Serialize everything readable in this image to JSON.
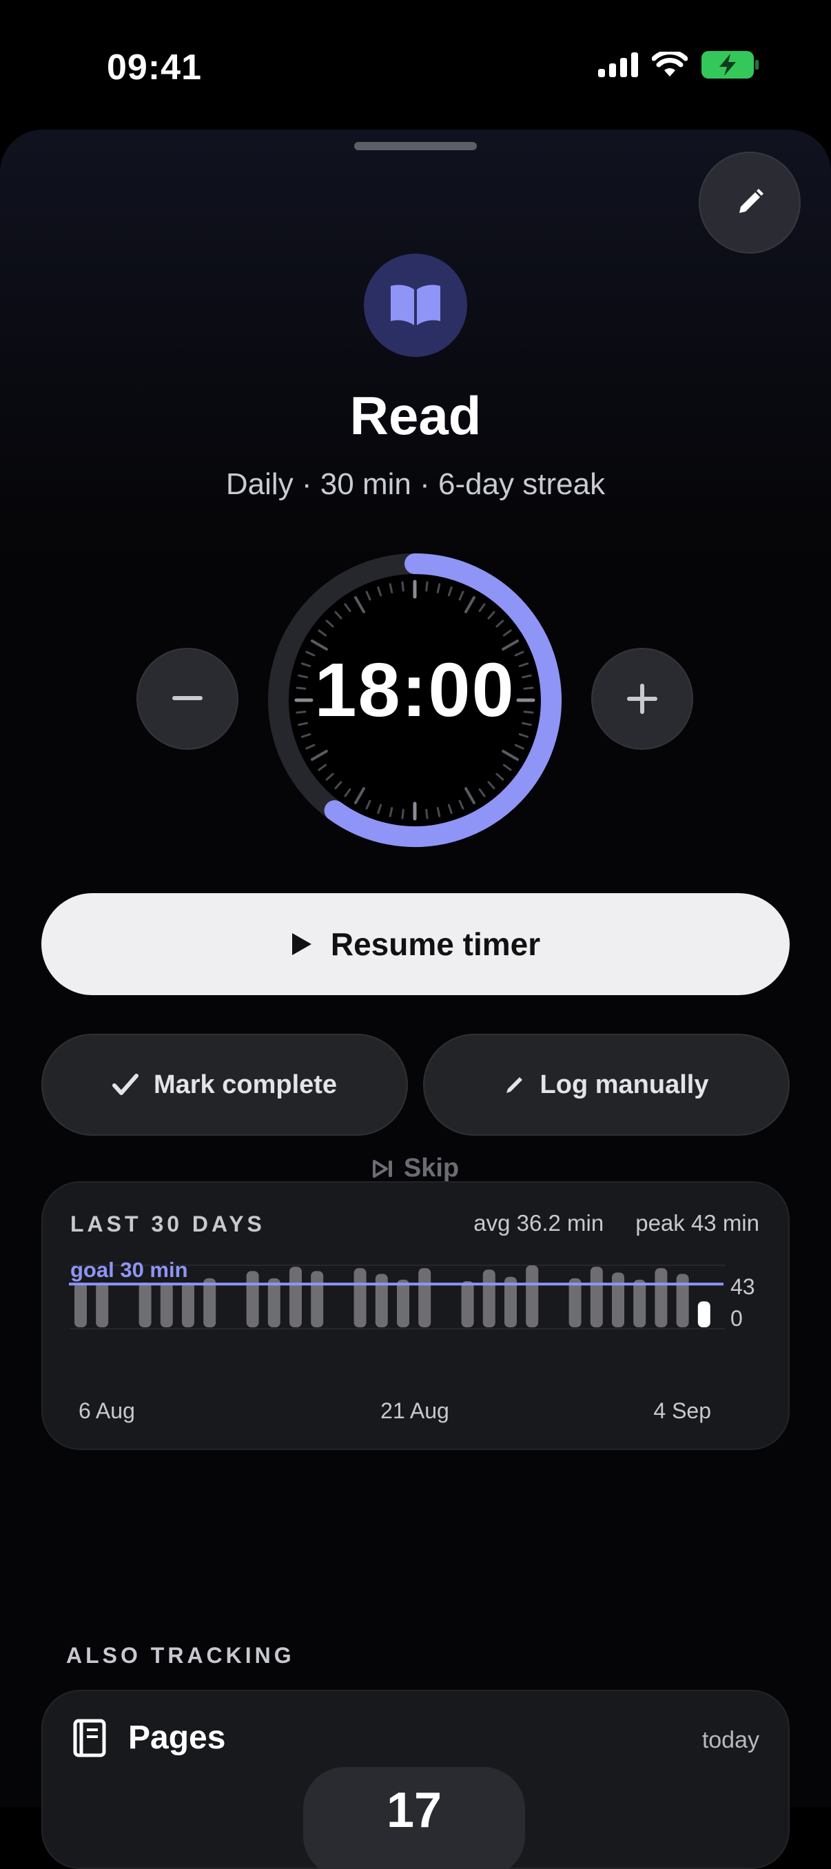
{
  "status_bar": {
    "time": "09:41",
    "battery_color": "#34c759"
  },
  "habit": {
    "icon": "open-book-icon",
    "title": "Read",
    "subtitle": "Daily · 30 min · 6-day streak",
    "accent_color": "#8e95f6"
  },
  "timer": {
    "display": "18:00",
    "progress_fraction": 0.6,
    "decrement_label": "−",
    "increment_label": "+"
  },
  "actions": {
    "resume_label": "Resume timer",
    "mark_complete_label": "Mark complete",
    "log_manually_label": "Log manually",
    "skip_label": "Skip"
  },
  "history": {
    "title": "LAST 30 DAYS",
    "avg_label": "avg 36.2 min",
    "peak_label": "peak 43 min",
    "goal_label": "goal 30 min",
    "y_max_label": "43",
    "y_min_label": "0",
    "x_labels": [
      "6 Aug",
      "21 Aug",
      "4 Sep"
    ]
  },
  "chart_data": {
    "type": "bar",
    "title": "LAST 30 DAYS",
    "categories": [
      "6 Aug",
      "7 Aug",
      "8 Aug",
      "9 Aug",
      "10 Aug",
      "11 Aug",
      "12 Aug",
      "13 Aug",
      "14 Aug",
      "15 Aug",
      "16 Aug",
      "17 Aug",
      "18 Aug",
      "19 Aug",
      "20 Aug",
      "21 Aug",
      "22 Aug",
      "23 Aug",
      "24 Aug",
      "25 Aug",
      "26 Aug",
      "27 Aug",
      "28 Aug",
      "29 Aug",
      "30 Aug",
      "31 Aug",
      "1 Sep",
      "2 Sep",
      "3 Sep",
      "4 Sep"
    ],
    "values": [
      31,
      31,
      0,
      31,
      31,
      31,
      34,
      0,
      39,
      34,
      42,
      39,
      0,
      41,
      37,
      33,
      41,
      0,
      32,
      40,
      35,
      43,
      0,
      34,
      42,
      38,
      33,
      41,
      37,
      18
    ],
    "goal": 30,
    "ylim": [
      0,
      43
    ],
    "x_tick_labels": [
      "6 Aug",
      "21 Aug",
      "4 Sep"
    ],
    "highlight_last": true,
    "bar_color": "#6e6e72",
    "today_color": "#ffffff",
    "goal_color": "#8e95f6"
  },
  "also_tracking": {
    "label": "ALSO TRACKING",
    "items": [
      {
        "icon": "book-icon",
        "name": "Pages",
        "when": "today",
        "value": "17"
      }
    ]
  }
}
